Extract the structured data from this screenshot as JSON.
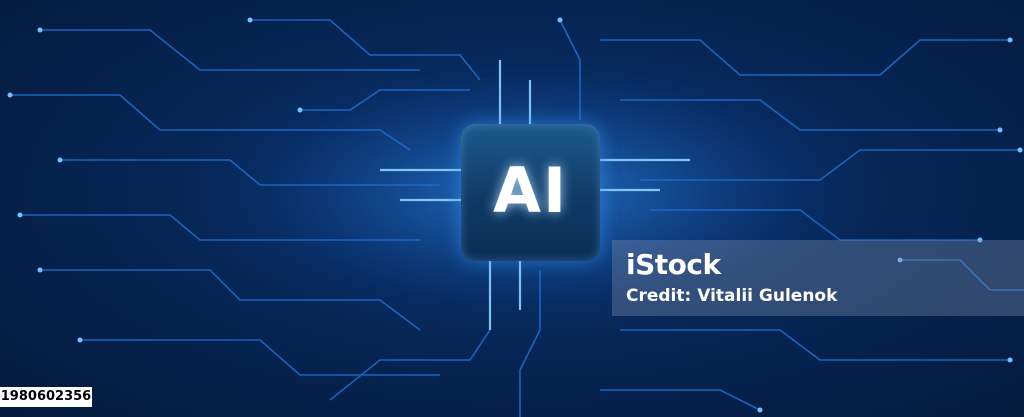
{
  "chip": {
    "label": "AI"
  },
  "watermark": {
    "brand": "iStock",
    "credit": "Credit: Vitalii Gulenok"
  },
  "image_id": "1980602356",
  "colors": {
    "background": "#05204a",
    "trace": "#1f6fd6",
    "glow": "#4fb0ff",
    "chip": "#0e3a66"
  }
}
